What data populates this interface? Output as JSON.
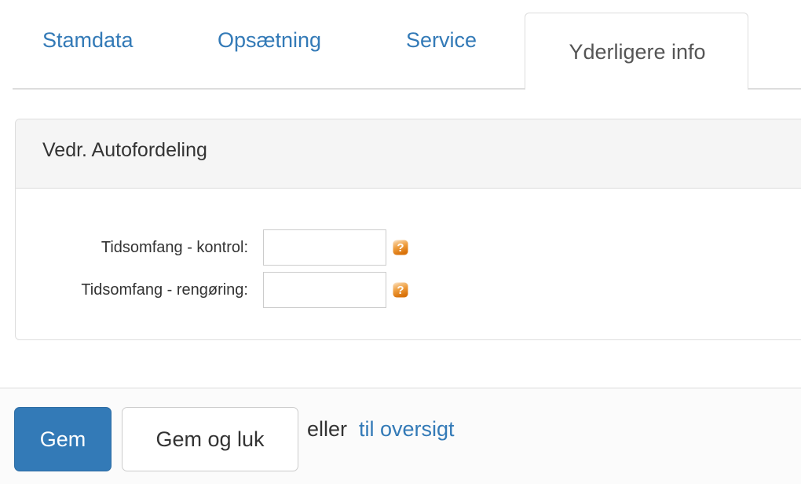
{
  "tabs": [
    {
      "label": "Stamdata",
      "active": false
    },
    {
      "label": "Opsætning",
      "active": false
    },
    {
      "label": "Service",
      "active": false
    },
    {
      "label": "Yderligere info",
      "active": true
    }
  ],
  "panel": {
    "title": "Vedr. Autofordeling",
    "fields": [
      {
        "label": "Tidsomfang - kontrol:",
        "value": "",
        "placeholder": "",
        "help_icon": "help-question-icon"
      },
      {
        "label": "Tidsomfang - rengøring:",
        "value": "",
        "placeholder": "",
        "help_icon": "help-question-icon"
      }
    ]
  },
  "footer": {
    "save_label": "Gem",
    "save_close_label": "Gem og luk",
    "or_text": "eller",
    "overview_link": "til oversigt"
  },
  "colors": {
    "link": "#337ab7",
    "primary_button": "#337ab7",
    "panel_header_bg": "#f5f5f5",
    "border": "#dddddd",
    "help_icon_orange": "#e8861a"
  }
}
